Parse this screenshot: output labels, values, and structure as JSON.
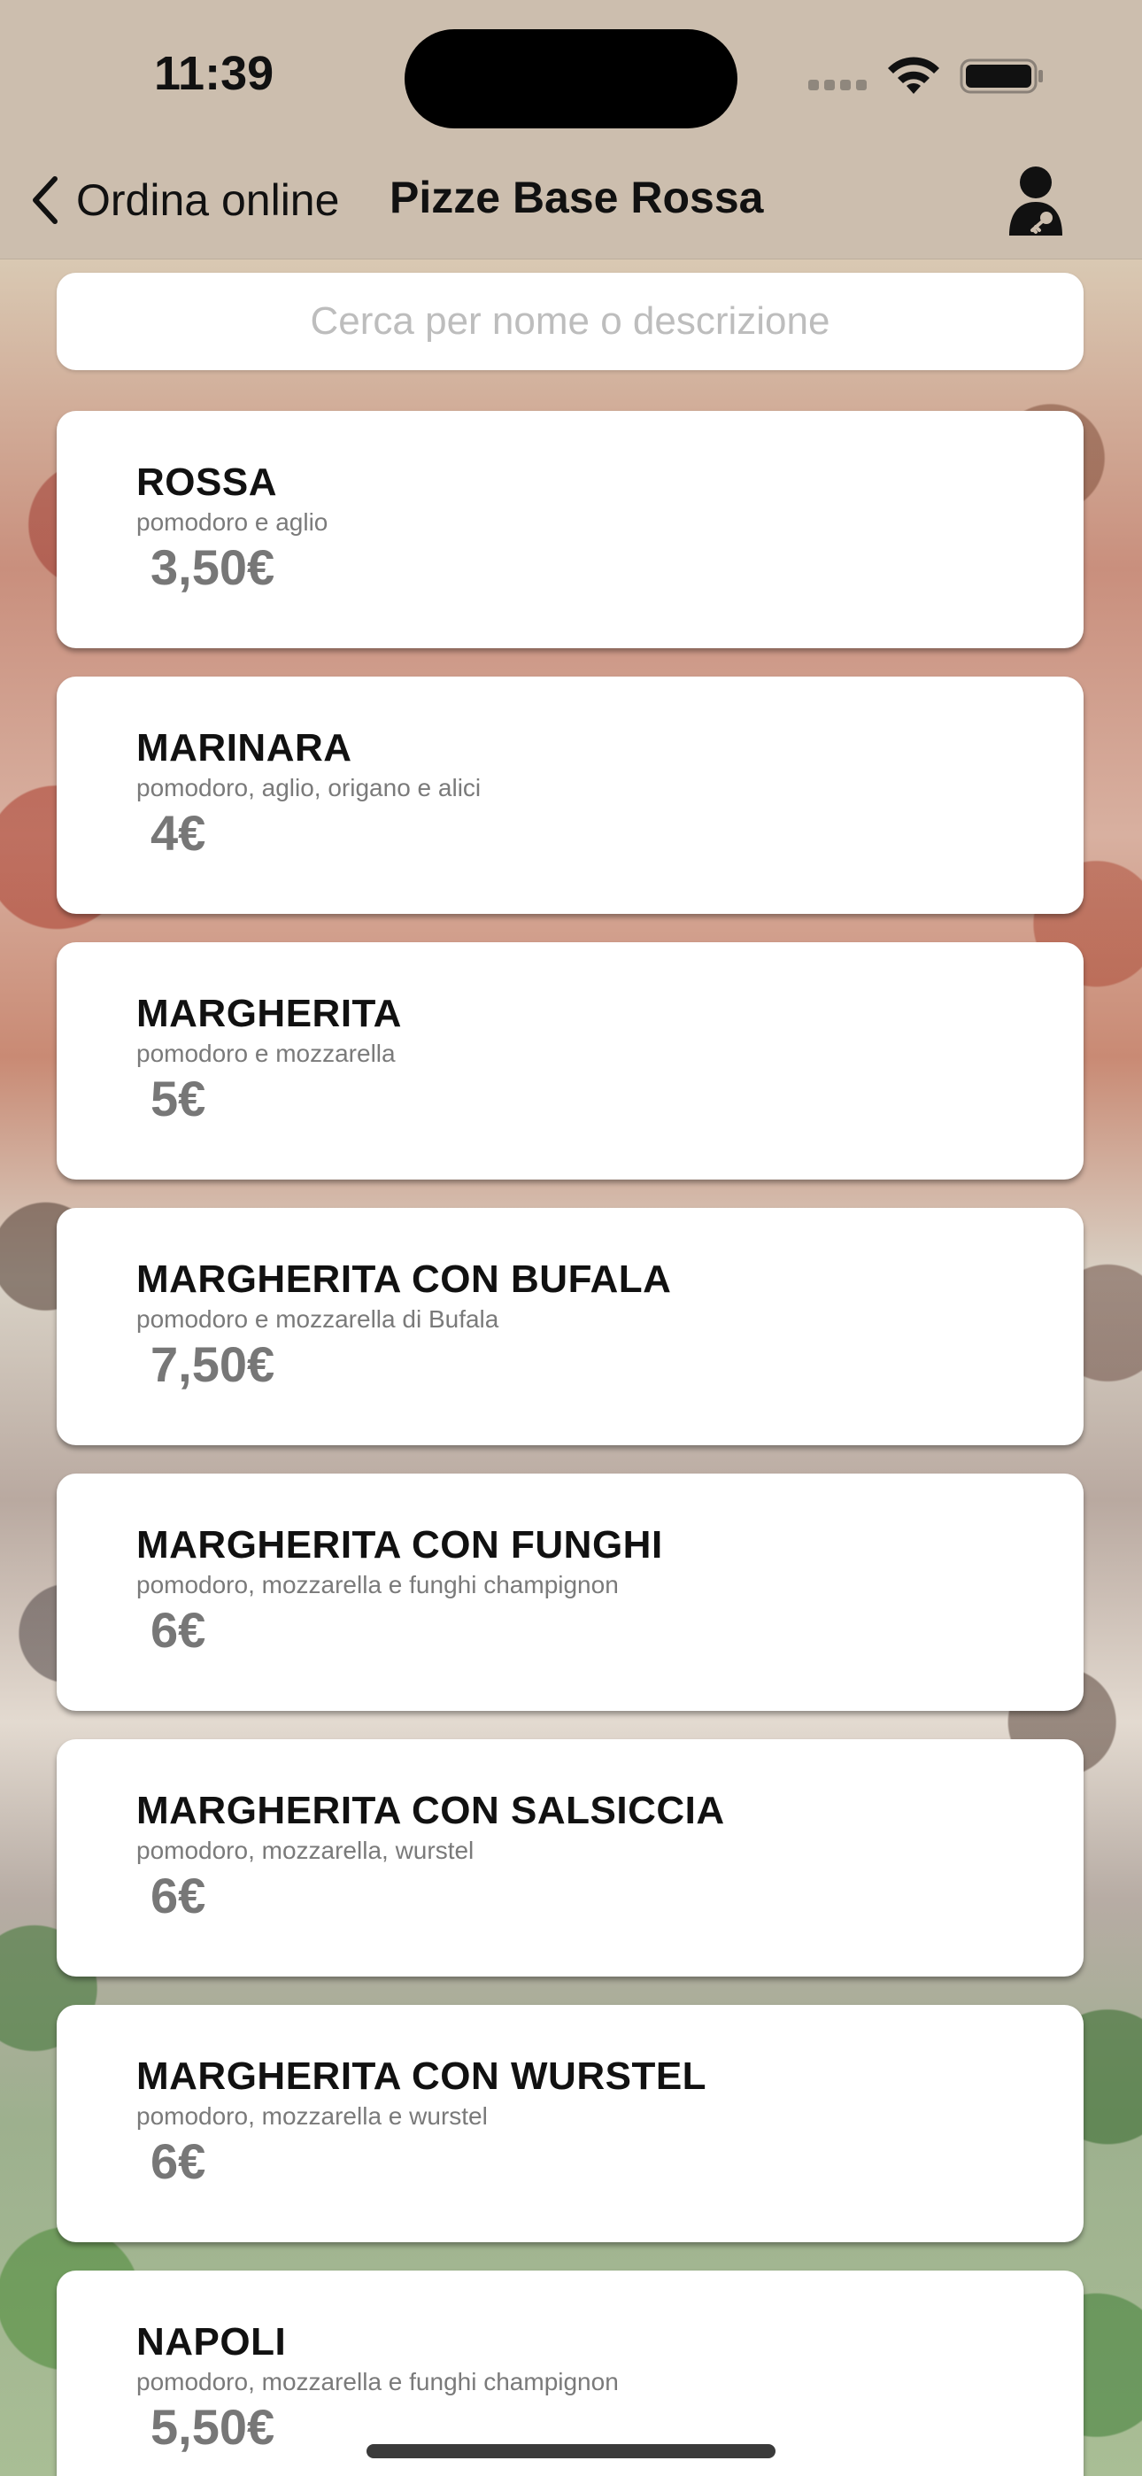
{
  "status_bar": {
    "time": "11:39"
  },
  "nav": {
    "back_label": "Ordina online",
    "title": "Pizze Base Rossa",
    "user_icon": "user-key-icon"
  },
  "search": {
    "placeholder": "Cerca per nome o descrizione",
    "value": ""
  },
  "menu": {
    "items": [
      {
        "name": "ROSSA",
        "description": "pomodoro e aglio",
        "price": "3,50€"
      },
      {
        "name": "MARINARA",
        "description": "pomodoro, aglio, origano e alici",
        "price": "4€"
      },
      {
        "name": "MARGHERITA",
        "description": "pomodoro e mozzarella",
        "price": "5€"
      },
      {
        "name": "MARGHERITA CON BUFALA",
        "description": "pomodoro e mozzarella di Bufala",
        "price": "7,50€"
      },
      {
        "name": "MARGHERITA CON FUNGHI",
        "description": "pomodoro, mozzarella e funghi champignon",
        "price": "6€"
      },
      {
        "name": "MARGHERITA CON SALSICCIA",
        "description": "pomodoro, mozzarella, wurstel",
        "price": "6€"
      },
      {
        "name": "MARGHERITA CON WURSTEL",
        "description": "pomodoro, mozzarella e wurstel",
        "price": "6€"
      },
      {
        "name": "NAPOLI",
        "description": "pomodoro, mozzarella e funghi champignon",
        "price": "5,50€"
      }
    ]
  },
  "colors": {
    "header_bg": "#ccbeae",
    "card_bg": "#ffffff",
    "price_text": "#777777"
  }
}
